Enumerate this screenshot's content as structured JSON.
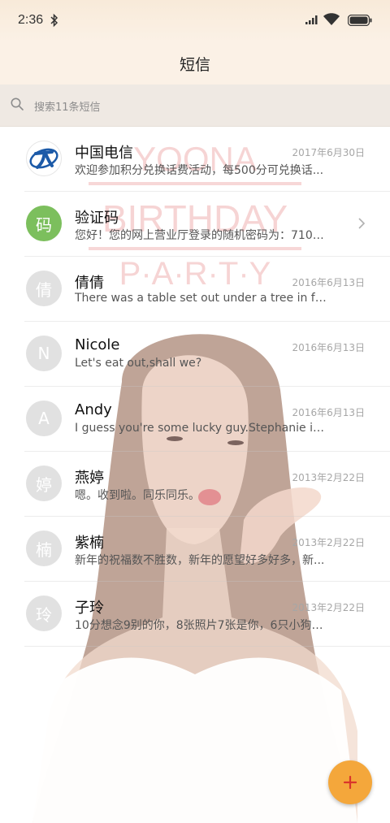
{
  "status": {
    "time": "2:36",
    "icons": [
      "bluetooth-icon",
      "signal-icon",
      "wifi-icon",
      "battery-icon"
    ]
  },
  "header": {
    "title": "短信"
  },
  "search": {
    "placeholder": "搜索11条短信"
  },
  "wallpaper": {
    "lines": [
      "YOONA",
      "BIRTHDAY",
      "P·A·R·T·Y"
    ]
  },
  "conversations": [
    {
      "name": "中国电信",
      "date": "2017年6月30日",
      "preview": "欢迎参加积分兑换话费活动，每500分可兑换话...",
      "avatar": "",
      "avatar_type": "logo"
    },
    {
      "name": "验证码",
      "date": "",
      "preview": "您好！您的网上营业厅登录的随机密码为：7106...",
      "avatar": "码",
      "avatar_type": "green"
    },
    {
      "name": "倩倩",
      "date": "2016年6月13日",
      "preview": "There was a table set out under a tree in fron...",
      "avatar": "倩",
      "avatar_type": "gray"
    },
    {
      "name": "Nicole",
      "date": "2016年6月13日",
      "preview": "Let's eat out,shall we?",
      "avatar": "N",
      "avatar_type": "gray"
    },
    {
      "name": "Andy",
      "date": "2016年6月13日",
      "preview": "I guess you're some lucky guy.Stephanie is a...",
      "avatar": "A",
      "avatar_type": "gray"
    },
    {
      "name": "燕婷",
      "date": "2013年2月22日",
      "preview": "嗯。收到啦。同乐同乐。",
      "avatar": "婷",
      "avatar_type": "gray"
    },
    {
      "name": "紫楠",
      "date": "2013年2月22日",
      "preview": "新年的祝福数不胜数，新年的愿望好多好多，新...",
      "avatar": "楠",
      "avatar_type": "gray"
    },
    {
      "name": "子玲",
      "date": "2013年2月22日",
      "preview": "10分想念9别的你，8张照片7张是你，6只小狗5...",
      "avatar": "玲",
      "avatar_type": "gray"
    }
  ],
  "colors": {
    "accent": "#f4a73b",
    "verify_green": "#7cbf5d"
  }
}
